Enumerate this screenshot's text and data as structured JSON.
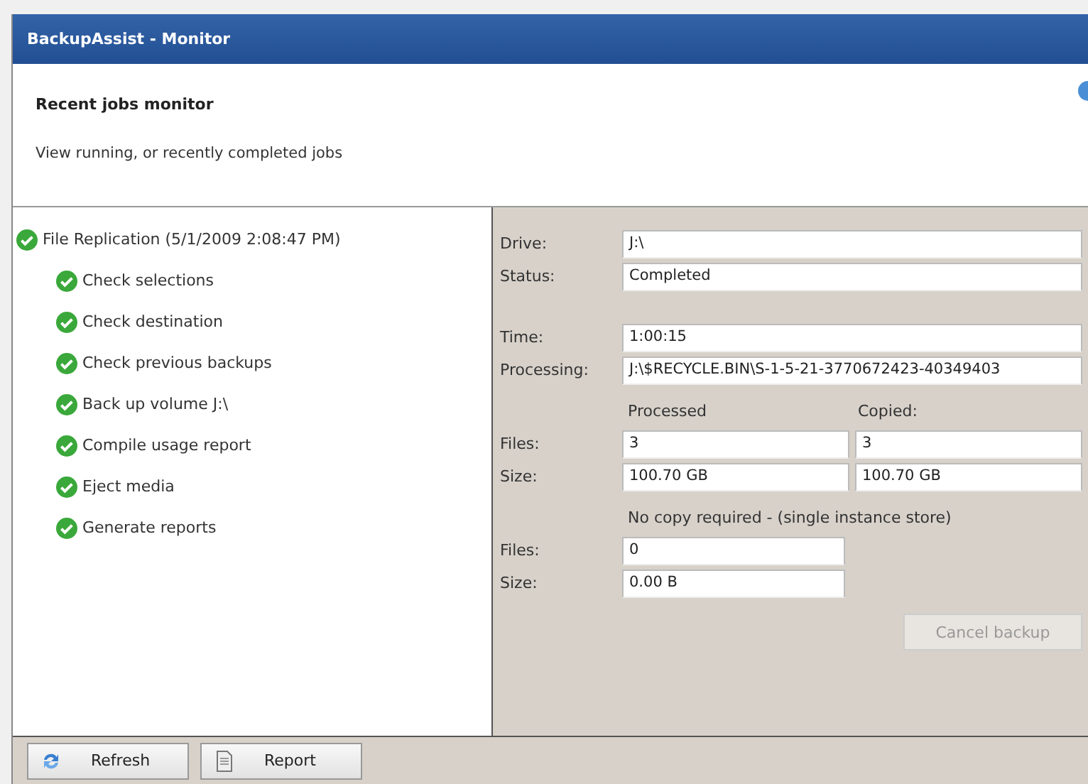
{
  "window": {
    "title": "BackupAssist - Monitor"
  },
  "header": {
    "title": "Recent jobs monitor",
    "subtitle": "View running, or recently completed jobs"
  },
  "jobs": [
    {
      "label": "File Replication (5/1/2009 2:08:47 PM)",
      "kind": "done",
      "children": [
        {
          "label": "Check selections",
          "kind": "done"
        },
        {
          "label": "Check destination",
          "kind": "done"
        },
        {
          "label": "Check previous backups",
          "kind": "done"
        },
        {
          "label": "Back up volume J:\\",
          "kind": "done"
        },
        {
          "label": "Compile usage report",
          "kind": "done"
        },
        {
          "label": "Eject media",
          "kind": "done"
        },
        {
          "label": "Generate reports",
          "kind": "done"
        }
      ]
    }
  ],
  "field_groups": [
    [
      {
        "label": "Drive:",
        "value": "J:\\"
      },
      {
        "label": "Status:",
        "value": "Completed"
      }
    ],
    [
      {
        "label": "Time:",
        "value": "1:00:15"
      },
      {
        "label": "Processing:",
        "value": "J:\\$RECYCLE.BIN\\S-1-5-21-3770672423-40349403"
      }
    ]
  ],
  "transfer": {
    "columns": [
      "Processed",
      "Copied:"
    ],
    "rows": [
      {
        "label": "Files:",
        "values": [
          "3",
          "3"
        ]
      },
      {
        "label": "Size:",
        "values": [
          "100.70 GB",
          "100.70 GB"
        ]
      }
    ]
  },
  "single_instance": {
    "title": "No copy required - (single instance store)",
    "rows": [
      {
        "label": "Files:",
        "value": "0"
      },
      {
        "label": "Size:",
        "value": "0.00 B"
      }
    ]
  },
  "cancel_button": {
    "label": "Cancel backup",
    "disabled": true
  },
  "footer_buttons": [
    {
      "label": "Refresh"
    },
    {
      "label": "Report"
    }
  ]
}
